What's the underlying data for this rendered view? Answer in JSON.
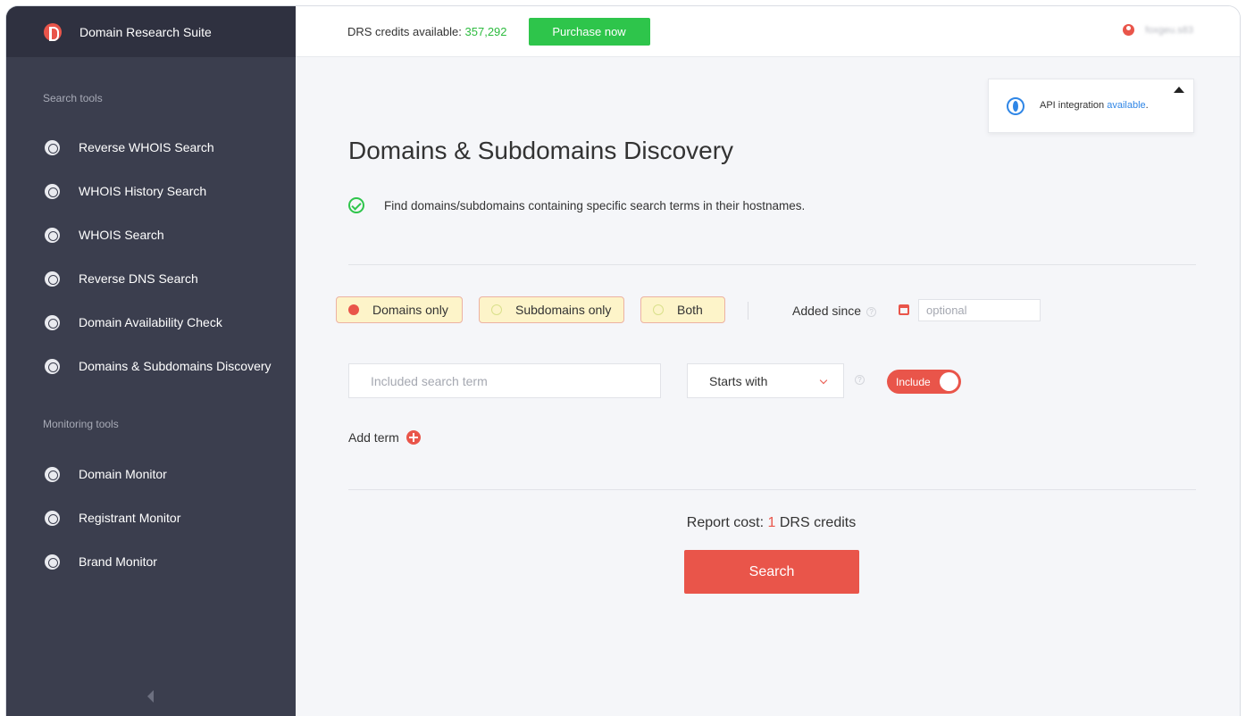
{
  "app": {
    "name": "Domain Research Suite"
  },
  "sidebar": {
    "search_tools_label": "Search tools",
    "search_items": [
      {
        "label": "Reverse WHOIS Search",
        "icon": "reverse-whois-icon"
      },
      {
        "label": "WHOIS History Search",
        "icon": "history-icon"
      },
      {
        "label": "WHOIS Search",
        "icon": "whois-user-icon"
      },
      {
        "label": "Reverse DNS Search",
        "icon": "globe-icon"
      },
      {
        "label": "Domain Availability Check",
        "icon": "exclamation-icon"
      },
      {
        "label": "Domains & Subdomains Discovery",
        "icon": "target-icon"
      }
    ],
    "monitoring_tools_label": "Monitoring tools",
    "monitoring_items": [
      {
        "label": "Domain Monitor",
        "icon": "domain-monitor-icon"
      },
      {
        "label": "Registrant Monitor",
        "icon": "registrant-monitor-icon"
      },
      {
        "label": "Brand Monitor",
        "icon": "brand-monitor-icon"
      }
    ]
  },
  "topbar": {
    "credits_label": "DRS credits available:",
    "credits_value": "357,292",
    "purchase_label": "Purchase now",
    "username": "foxgeu.s83"
  },
  "api_notice": {
    "text": "API integration ",
    "link": "available",
    "suffix": "."
  },
  "page": {
    "title": "Domains & Subdomains Discovery",
    "description": "Find domains/subdomains containing specific search terms in their hostnames."
  },
  "filters": {
    "options": [
      "Domains only",
      "Subdomains only",
      "Both"
    ],
    "selected": "Domains only",
    "added_since_label": "Added since",
    "date_placeholder": "optional"
  },
  "term": {
    "placeholder": "Included search term",
    "match_mode": "Starts with",
    "toggle_label": "Include",
    "add_term_label": "Add term"
  },
  "report": {
    "cost_label": "Report cost:",
    "cost_value": "1",
    "cost_unit": "DRS credits",
    "search_label": "Search"
  },
  "colors": {
    "accent": "#e9554a",
    "success": "#2ec54b",
    "sidebar": "#3b3e4e",
    "link": "#2f86e6"
  }
}
